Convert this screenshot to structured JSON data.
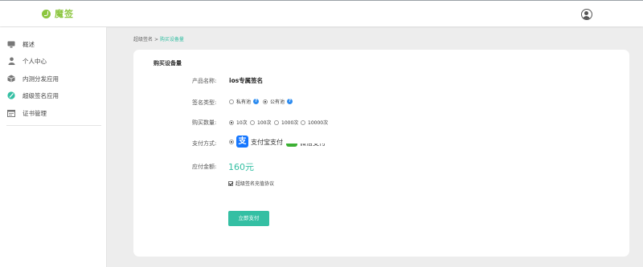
{
  "brand": {
    "name": "魔签",
    "color": "#8cc63f",
    "accent": "#34bfa3"
  },
  "header": {
    "avatar_icon": "user-avatar-icon"
  },
  "sidebar": {
    "items": [
      {
        "label": "概述",
        "icon": "monitor-icon"
      },
      {
        "label": "个人中心",
        "icon": "user-icon"
      },
      {
        "label": "内测分发应用",
        "icon": "cube-icon"
      },
      {
        "label": "超级签名应用",
        "icon": "feather-icon"
      },
      {
        "label": "证书管理",
        "icon": "certificate-icon"
      }
    ]
  },
  "breadcrumb": {
    "parent": "超级签名",
    "separator": ">",
    "current": "购买设备量"
  },
  "form": {
    "title": "购买设备量",
    "product": {
      "label": "产品名称:",
      "value": "ios专属签名"
    },
    "sign_type": {
      "label": "签名类型:",
      "options": [
        {
          "label": "私有池",
          "selected": false
        },
        {
          "label": "公有池",
          "selected": true
        }
      ]
    },
    "quantity": {
      "label": "购买数量:",
      "options": [
        {
          "label": "10次",
          "selected": true
        },
        {
          "label": "100次",
          "selected": false
        },
        {
          "label": "1000次",
          "selected": false
        },
        {
          "label": "10000次",
          "selected": false
        }
      ]
    },
    "payment": {
      "label": "支付方式:",
      "options": [
        {
          "label": "支付宝支付",
          "icon": "alipay-icon",
          "selected": true
        },
        {
          "label": "微信支付",
          "icon": "wechat-pay-icon",
          "selected": false
        }
      ]
    },
    "amount": {
      "label": "应付金额:",
      "value": "160元"
    },
    "agreement": {
      "label": "超级签名充值协议",
      "checked": true
    },
    "submit": {
      "label": "立即支付"
    }
  }
}
